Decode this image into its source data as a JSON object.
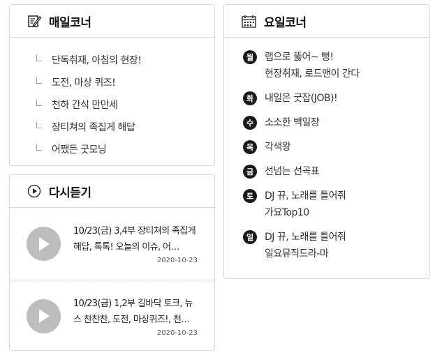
{
  "daily": {
    "title": "매일코너",
    "icon": "note-edit-icon",
    "items": [
      {
        "label": "단독취재, 아침의 현장!"
      },
      {
        "label": "도전, 마상 퀴즈!"
      },
      {
        "label": "천하 간식 만만세"
      },
      {
        "label": "장티쳐의 족집게 해답"
      },
      {
        "label": "어쨌든 굿모닝"
      }
    ]
  },
  "weekday": {
    "title": "요일코너",
    "icon": "calendar-icon",
    "items": [
      {
        "day": "월",
        "line1": "랩으로 뚫어~ 뻥!",
        "line2": "현장취재, 로드맨이 간다"
      },
      {
        "day": "화",
        "line1": "내일은 굿잡(JOB)!",
        "line2": ""
      },
      {
        "day": "수",
        "line1": "소소한 백일장",
        "line2": ""
      },
      {
        "day": "목",
        "line1": "각색왕",
        "line2": ""
      },
      {
        "day": "금",
        "line1": "선넘는 선곡표",
        "line2": ""
      },
      {
        "day": "토",
        "line1": "DJ 뀨, 노래를 틀어줘",
        "line2": "가요Top10"
      },
      {
        "day": "일",
        "line1": "DJ 뀨, 노래를 틀어줘",
        "line2": "일요뮤직드라-마"
      }
    ]
  },
  "replay": {
    "title": "다시듣기",
    "icon": "play-circle-icon",
    "items": [
      {
        "title": "10/23(금) 3,4부 장티쳐의 족집게 해답, 톡톡! 오늘의 이슈, 어…",
        "date": "2020-10-23"
      },
      {
        "title": "10/23(금) 1,2부 길바닥 토크, 뉴스 찬찬찬, 도전, 마상퀴즈!, 천…",
        "date": "2020-10-23"
      }
    ]
  },
  "colors": {
    "border": "#d9d9d9",
    "badge": "#1a1a1a",
    "play_button": "#bdbdbd"
  }
}
